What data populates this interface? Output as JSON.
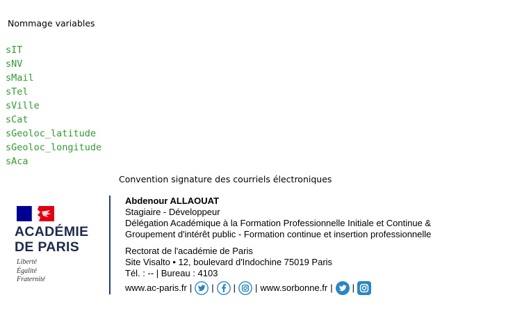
{
  "header": {
    "title": "Nommage variables"
  },
  "variables": [
    "sIT",
    "sNV",
    "sMail",
    "sTel",
    "sVille",
    "sCat",
    "sGeoloc_latitude",
    "sGeoloc_longitude",
    "sAca"
  ],
  "convention": {
    "title": "Convention signature des courriels électroniques"
  },
  "logo": {
    "name_line1": "ACADÉMIE",
    "name_line2": "DE PARIS",
    "motto1": "Liberté",
    "motto2": "Égalité",
    "motto3": "Fraternité",
    "flag_colors": [
      "#000091",
      "#ffffff",
      "#e1000f"
    ]
  },
  "signature": {
    "name": "Abdenour ALLAOUAT",
    "role": "Stagiaire - Développeur",
    "dept_line1": "Délégation Académique à la Formation Professionnelle Initiale et Continue &",
    "dept_line2": "Groupement d'intérêt public - Formation continue et insertion professionnelle",
    "org": "Rectorat de l'académie de Paris",
    "address": "Site Visalto • 12, boulevard d'Indochine 75019 Paris",
    "phone": "Tél. : -- | Bureau : 4103",
    "link1": "www.ac-paris.fr",
    "link2": "www.sorbonne.fr",
    "separator": "|"
  },
  "icons": {
    "twitter": "twitter-icon",
    "facebook": "facebook-icon",
    "instagram": "instagram-icon",
    "color": "#2e86c1"
  }
}
